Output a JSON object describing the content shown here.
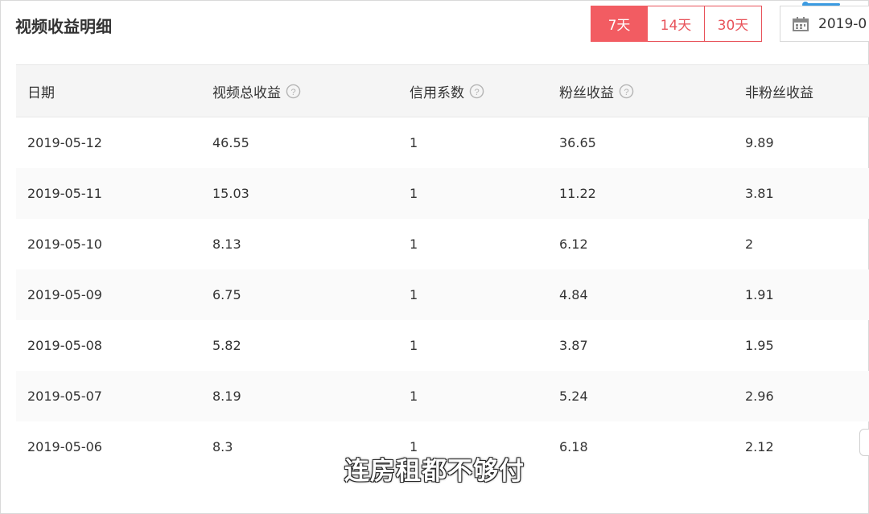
{
  "page": {
    "title": "视频收益明细"
  },
  "range_buttons": [
    {
      "label": "7天",
      "active": true
    },
    {
      "label": "14天",
      "active": false
    },
    {
      "label": "30天",
      "active": false
    }
  ],
  "date_picker": {
    "value": "2019-0",
    "icon": "calendar-icon"
  },
  "table": {
    "headers": {
      "date": "日期",
      "total": "视频总收益",
      "credit": "信用系数",
      "fans": "粉丝收益",
      "nonfans": "非粉丝收益"
    },
    "rows": [
      {
        "date": "2019-05-12",
        "total": "46.55",
        "credit": "1",
        "fans": "36.65",
        "nonfans": "9.89"
      },
      {
        "date": "2019-05-11",
        "total": "15.03",
        "credit": "1",
        "fans": "11.22",
        "nonfans": "3.81"
      },
      {
        "date": "2019-05-10",
        "total": "8.13",
        "credit": "1",
        "fans": "6.12",
        "nonfans": "2"
      },
      {
        "date": "2019-05-09",
        "total": "6.75",
        "credit": "1",
        "fans": "4.84",
        "nonfans": "1.91"
      },
      {
        "date": "2019-05-08",
        "total": "5.82",
        "credit": "1",
        "fans": "3.87",
        "nonfans": "1.95"
      },
      {
        "date": "2019-05-07",
        "total": "8.19",
        "credit": "1",
        "fans": "5.24",
        "nonfans": "2.96"
      },
      {
        "date": "2019-05-06",
        "total": "8.3",
        "credit": "1",
        "fans": "6.18",
        "nonfans": "2.12"
      }
    ]
  },
  "subtitle": "连房租都不够付",
  "colors": {
    "accent": "#f25c62",
    "accent_border": "#e8535a"
  }
}
